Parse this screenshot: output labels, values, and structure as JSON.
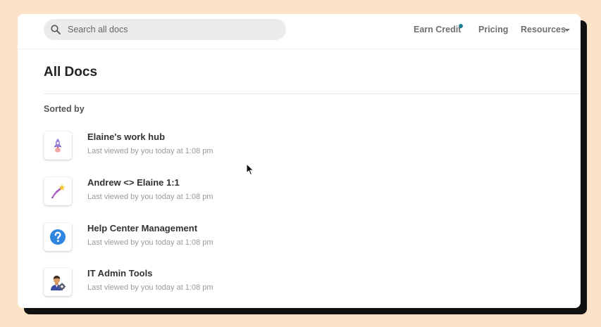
{
  "search": {
    "placeholder": "Search all docs"
  },
  "nav": {
    "earn_credit": "Earn Credit",
    "pricing": "Pricing",
    "resources": "Resources"
  },
  "page": {
    "title": "All Docs",
    "sorted_by": "Sorted by"
  },
  "docs": [
    {
      "title": "Elaine's work hub",
      "meta": "Last viewed by you today at 1:08 pm",
      "icon": "rocket-icon"
    },
    {
      "title": "Andrew <> Elaine 1:1",
      "meta": "Last viewed by you today at 1:08 pm",
      "icon": "shooting-star-icon"
    },
    {
      "title": "Help Center Management",
      "meta": "Last viewed by you today at 1:08 pm",
      "icon": "question-mark-icon"
    },
    {
      "title": "IT Admin Tools",
      "meta": "Last viewed by you today at 1:08 pm",
      "icon": "technician-icon"
    }
  ],
  "colors": {
    "backdrop": "#fce3c8",
    "notification_dot": "#1f7e96",
    "help_icon": "#2f86e0"
  }
}
